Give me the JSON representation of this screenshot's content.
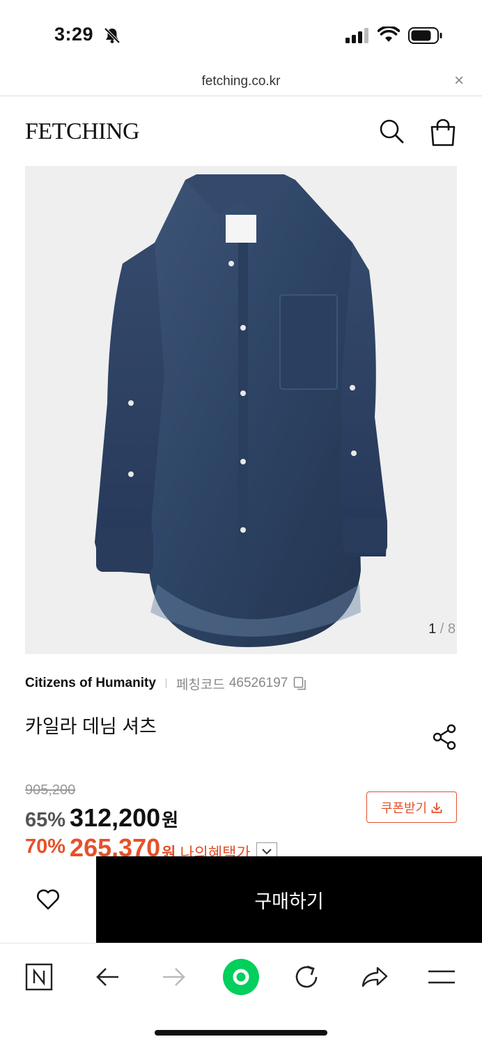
{
  "status_bar": {
    "time": "3:29"
  },
  "url_bar": {
    "domain": "fetching.co.kr",
    "close_label": "×"
  },
  "header": {
    "logo": "FETCHING"
  },
  "gallery": {
    "current": "1",
    "separator": "/",
    "total": "8"
  },
  "product": {
    "brand": "Citizens of Humanity",
    "code_label": "페칭코드",
    "code_value": "46526197",
    "title": "카일라 데님 셔츠",
    "original_price": "905,200",
    "discount": "65%",
    "price": "312,200",
    "currency": "원",
    "coupon_label": "쿠폰받기",
    "benefit_discount": "70%",
    "benefit_price": "265,370",
    "benefit_currency": "원",
    "benefit_label": "나의혜택가"
  },
  "actions": {
    "buy_label": "구매하기"
  },
  "colors": {
    "accent": "#e5512a",
    "buy_background": "#000000",
    "naver_green": "#03cf5d",
    "denim": "#2e4566"
  },
  "icons": [
    "bell-slash-icon",
    "signal-icon",
    "wifi-icon",
    "battery-icon",
    "search-icon",
    "shopping-bag-icon",
    "copy-icon",
    "share-icon",
    "download-icon",
    "chevron-down-icon",
    "heart-icon",
    "naver-n-icon",
    "back-arrow-icon",
    "forward-arrow-icon",
    "green-dot-icon",
    "reload-icon",
    "share-arrow-icon",
    "menu-icon"
  ]
}
